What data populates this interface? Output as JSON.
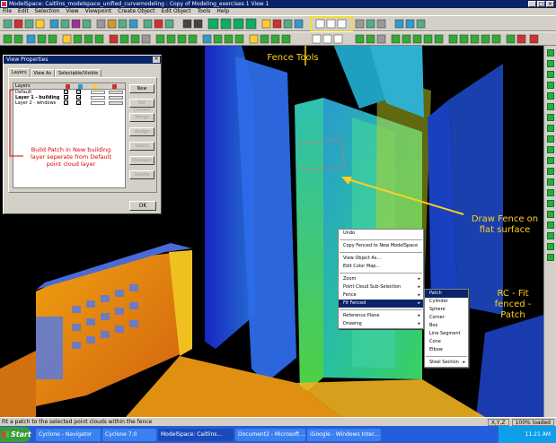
{
  "window": {
    "title": "ModelSpace: Caitlins_modelspace_unified_curvemodeling : Copy of Modeling_exercises 1 View 1"
  },
  "menu": [
    "File",
    "Edit",
    "Selection",
    "View",
    "Viewpoint",
    "Create Object",
    "Edit Object",
    "Tools",
    "Help"
  ],
  "dialog": {
    "title": "View Properties",
    "tabs": [
      "Layers",
      "View As",
      "Selectable/Visible"
    ],
    "list_header": "Layers",
    "rows": [
      "Default",
      "Layer 1 - building",
      "Layer 2 - windows"
    ],
    "buttons": {
      "new": "New",
      "set_current": "Set Current",
      "merge": "Merge",
      "assign": "Assign",
      "select": "Select",
      "deselect": "Deselect",
      "delete": "Delete"
    },
    "ok": "OK"
  },
  "context_menu": {
    "items": [
      "Undo",
      "Copy Fenced to New ModelSpace",
      "View Object As...",
      "Edit Color Map...",
      "Zoom",
      "Point Cloud Sub-Selection",
      "Fence",
      "Fit Fenced",
      "Reference Plane",
      "Drawing"
    ],
    "highlight": "Fit Fenced"
  },
  "submenu": {
    "items": [
      "Patch",
      "Cylinder",
      "Sphere",
      "Corner",
      "Box",
      "Line Segment",
      "Cone",
      "Elbow",
      "Steel Section"
    ],
    "highlight": "Patch"
  },
  "annotations": {
    "fence_tools": "Fence Tools",
    "draw_fence": "Draw Fence on flat surface",
    "rc_fit": "RC - Fit fenced - Patch",
    "build_patch": "Build Patch in New building layer seperate from Default point cloud layer"
  },
  "status": {
    "text": "Fit a patch to the selected point clouds within the fence",
    "coords": "X,Y,Z",
    "loaded": "100% loaded"
  },
  "taskbar": {
    "start": "Start",
    "tasks": [
      "Cyclone - Navigator",
      "Cyclone 7.0",
      "ModelSpace: Caitlins...",
      "Document2 - Microsoft ...",
      "iGoogle - Windows Inter..."
    ],
    "clock": "11:21 AM"
  },
  "colors": {
    "title": "#0a246a",
    "annotation": "#ffd020",
    "label_red": "#dd0000",
    "highlight": "#0a246a"
  }
}
